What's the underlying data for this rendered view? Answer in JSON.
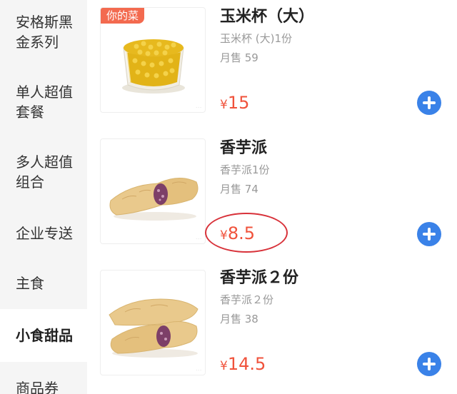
{
  "sidebar": {
    "items": [
      {
        "label": "安格斯黑\n金系列",
        "active": false
      },
      {
        "label": "单人超值\n套餐",
        "active": false
      },
      {
        "label": "多人超值\n组合",
        "active": false
      },
      {
        "label": "企业专送",
        "active": false
      },
      {
        "label": "主食",
        "active": false
      },
      {
        "label": "小食甜品",
        "active": true
      },
      {
        "label": "商品券",
        "active": false
      }
    ]
  },
  "products": [
    {
      "badge": "你的菜",
      "name": "玉米杯（大）",
      "desc": "玉米杯 (大)1份",
      "sold": "月售 59",
      "currency": "¥",
      "price": "15",
      "image_icon": "corn-cup-icon"
    },
    {
      "name": "香芋派",
      "desc": "香芋派1份",
      "sold": "月售 74",
      "currency": "¥",
      "price": "8.5",
      "image_icon": "taro-pie-icon"
    },
    {
      "name": "香芋派２份",
      "desc": "香芋派２份",
      "sold": "月售 38",
      "currency": "¥",
      "price": "14.5",
      "image_icon": "taro-pie-double-icon"
    }
  ],
  "colors": {
    "price": "#f0523b",
    "badge": "#f36a4f",
    "add_button": "#3a82e8",
    "annotation_circle": "#d8323a",
    "sidebar_bg": "#f5f5f5"
  }
}
